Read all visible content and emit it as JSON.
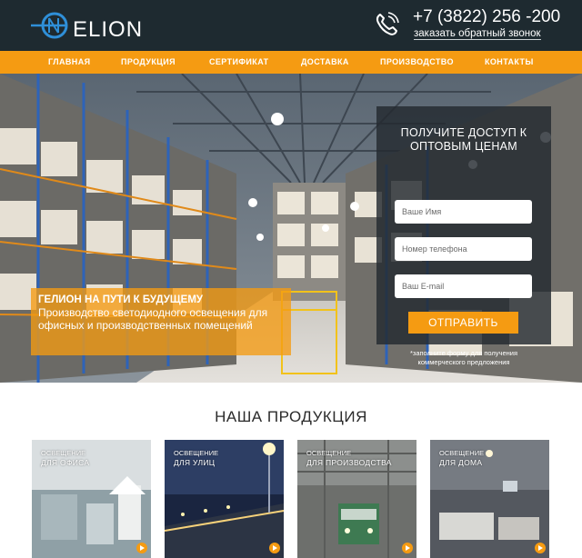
{
  "header": {
    "logo_text": "ELION",
    "logo_letter": "G",
    "phone": "+7 (3822) 256 -200",
    "callback": "заказать обратный звонок"
  },
  "nav": {
    "items": [
      "ГЛАВНАЯ",
      "ПРОДУКЦИЯ",
      "СЕРТИФИКАТ",
      "ДОСТАВКА",
      "ПРОИЗВОДСТВО",
      "КОНТАКТЫ"
    ]
  },
  "hero": {
    "promo_title": "ГЕЛИОН НА ПУТИ К БУДУЩЕМУ",
    "promo_text": "Производство светодиодного освещения для офисных и производственных помещений",
    "form": {
      "title_line1": "ПОЛУЧИТЕ ДОСТУП К",
      "title_line2": "ОПТОВЫМ ЦЕНАМ",
      "name_placeholder": "Ваше Имя",
      "phone_placeholder": "Номер телефона",
      "email_placeholder": "Ваш E-mail",
      "submit": "ОТПРАВИТЬ",
      "note_line1": "*заполните форму для получения",
      "note_line2": "коммерческого предложения"
    }
  },
  "products": {
    "title": "НАША ПРОДУКЦИЯ",
    "cards": [
      {
        "line1": "ОСВЕЩЕНИЕ",
        "line2": "ДЛЯ ОФИСА"
      },
      {
        "line1": "ОСВЕЩЕНИЕ",
        "line2": "ДЛЯ УЛИЦ"
      },
      {
        "line1": "ОСВЕЩЕНИЕ",
        "line2": "ДЛЯ ПРОИЗВОДСТВА"
      },
      {
        "line1": "ОСВЕЩЕНИЕ",
        "line2": "ДЛЯ ДОМА"
      }
    ]
  },
  "colors": {
    "accent": "#f59b12",
    "header_bg": "#1e2a30"
  }
}
